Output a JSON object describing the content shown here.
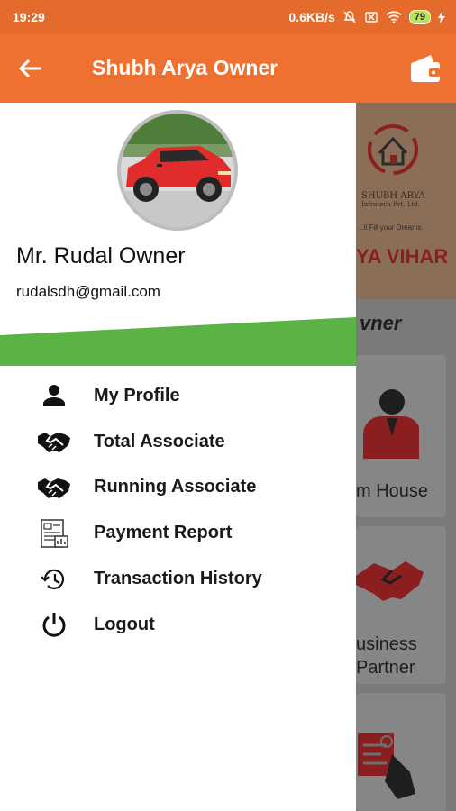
{
  "status_bar": {
    "time": "19:29",
    "network_speed": "0.6KB/s",
    "battery_level": "79",
    "icons": [
      "mute-bell-icon",
      "no-sim-icon",
      "wifi-icon",
      "battery-icon",
      "charging-icon"
    ]
  },
  "app_bar": {
    "title": "Shubh Arya Owner",
    "back_icon": "arrow-left-icon",
    "wallet_icon": "wallet-icon"
  },
  "drawer": {
    "user": {
      "name": "Mr. Rudal Owner",
      "email": "rudalsdh@gmail.com"
    },
    "accent_color": "#5bb346",
    "menu": [
      {
        "label": "My Profile",
        "icon": "person-icon"
      },
      {
        "label": "Total Associate",
        "icon": "handshake-icon"
      },
      {
        "label": "Running Associate",
        "icon": "handshake-icon"
      },
      {
        "label": "Payment Report",
        "icon": "report-icon"
      },
      {
        "label": "Transaction History",
        "icon": "history-icon"
      },
      {
        "label": "Logout",
        "icon": "power-icon"
      }
    ]
  },
  "background_page": {
    "company": "SHUBH ARYA",
    "company_sub": "Infratech Pvt. Ltd.",
    "tagline": "...ll Fill your Dreams.",
    "banner_text": "YA VIHAR",
    "section_title": "vner",
    "cards": [
      {
        "label": "m House"
      },
      {
        "label_line1": "usiness",
        "label_line2": "Partner"
      }
    ]
  },
  "colors": {
    "status_bar": "#e46b2b",
    "app_bar": "#ef7132",
    "accent_green": "#5bb346"
  }
}
